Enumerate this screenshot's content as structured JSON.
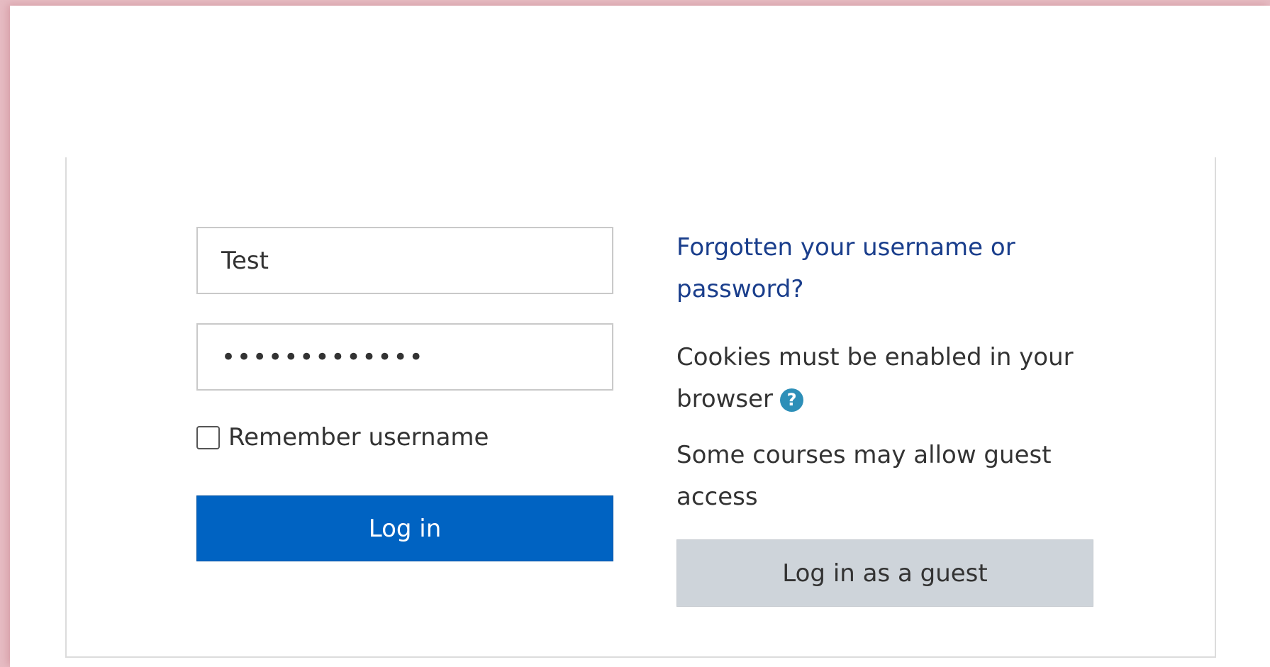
{
  "login_form": {
    "username_value": "Test",
    "password_value": "•••••••••••••",
    "remember_label": "Remember username",
    "login_button": "Log in"
  },
  "info": {
    "forgot_link": "Forgotten your username or password?",
    "cookies_text": "Cookies must be enabled in your browser",
    "help_icon_glyph": "?",
    "guest_text": "Some courses may allow guest access",
    "guest_button": "Log in as a guest"
  },
  "colors": {
    "primary_button": "#0063c2",
    "secondary_button": "#ced4da",
    "link": "#1a3e8c",
    "help_icon": "#2d8fb8"
  },
  "icons": {
    "help": "question-circle-icon"
  }
}
